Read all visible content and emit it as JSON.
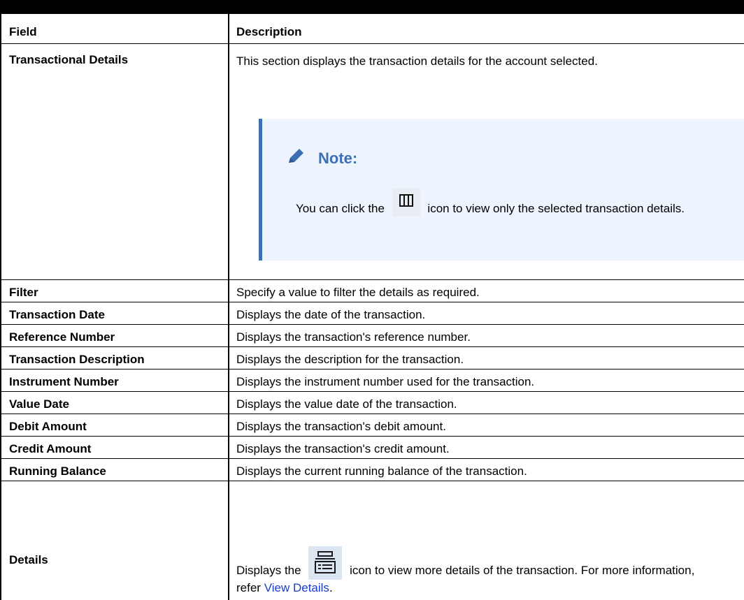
{
  "table": {
    "headers": [
      "Field",
      "Description"
    ],
    "rows": [
      {
        "field": "Transactional Details",
        "description": "This section displays the transaction details for the account selected."
      },
      {
        "field": "Filter",
        "description": "Specify a value to filter the details as required."
      },
      {
        "field": "Transaction Date",
        "description": "Displays the date of the transaction."
      },
      {
        "field": "Reference Number",
        "description": "Displays the transaction's reference number."
      },
      {
        "field": "Transaction Description",
        "description": "Displays the description for the transaction."
      },
      {
        "field": "Instrument Number",
        "description": "Displays the instrument number used for the transaction."
      },
      {
        "field": "Value Date",
        "description": "Displays the value date of the transaction."
      },
      {
        "field": "Debit Amount",
        "description": "Displays the transaction's debit amount."
      },
      {
        "field": "Credit Amount",
        "description": "Displays the transaction's credit amount."
      },
      {
        "field": "Running Balance",
        "description": "Displays the current running balance of the transaction."
      },
      {
        "field": "Details",
        "description_before": "Displays the",
        "description_after": "icon to view more details of the transaction. For more information, refer",
        "link": "View Details",
        "end": "."
      }
    ]
  },
  "note": {
    "title": "Note:",
    "text_before": "You can click the",
    "text_after": "icon to view only the selected transaction details.",
    "icon": "columns-icon"
  },
  "details_icon": "details-card-icon"
}
